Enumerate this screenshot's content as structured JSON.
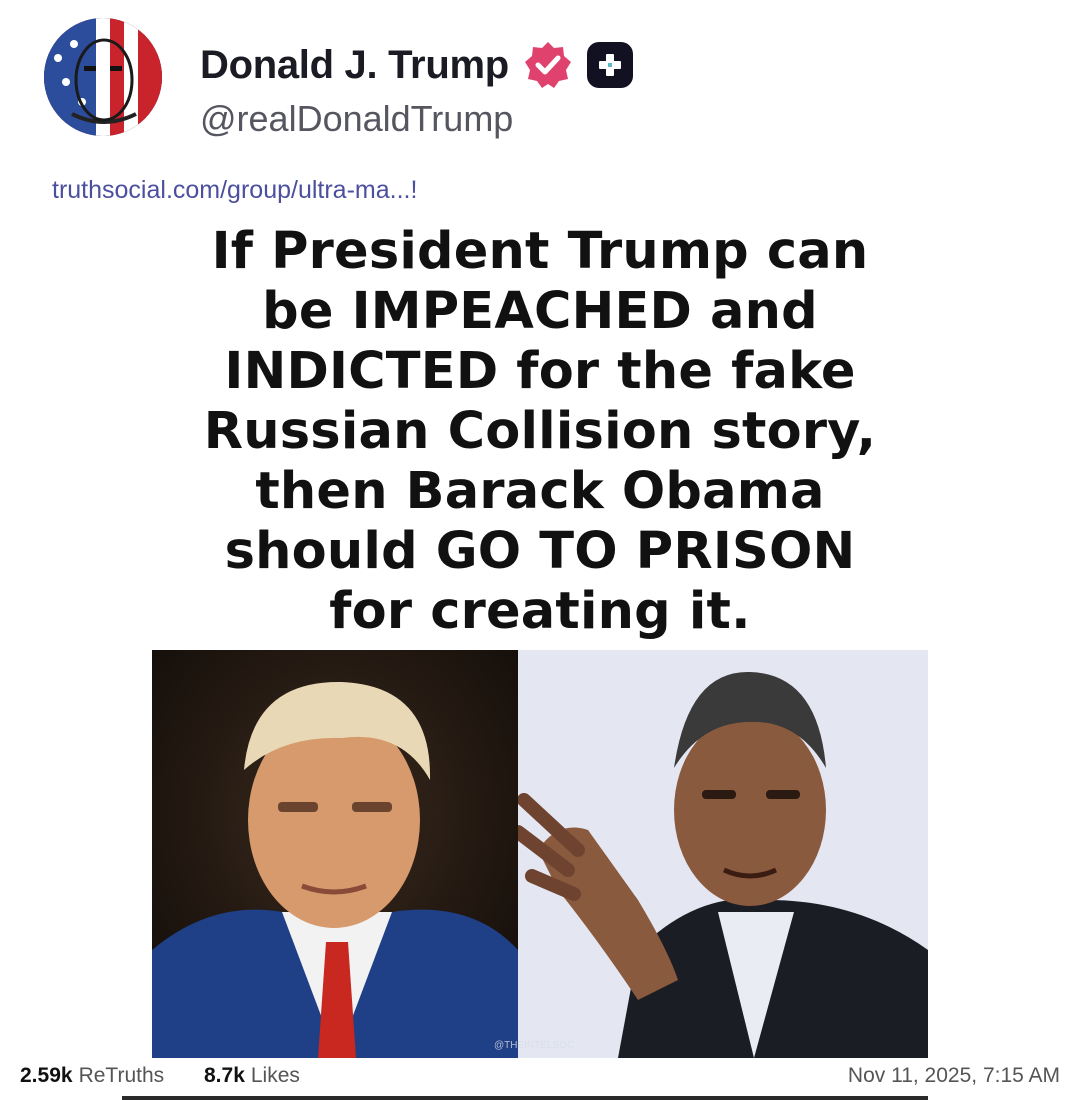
{
  "post": {
    "author": {
      "display_name": "Donald J. Trump",
      "handle": "@realDonaldTrump",
      "verified_icon": "verified-badge-icon",
      "plus_icon": "plus-badge-icon"
    },
    "link_text": "truthsocial.com/group/ultra-ma...!",
    "image_text_lines": [
      "If President Trump can",
      "be IMPEACHED and",
      "INDICTED for the fake",
      "Russian Collision story,",
      "then Barack Obama",
      "should GO TO PRISON",
      "for creating it."
    ],
    "watermark": "@THEINTELSOC",
    "stats": {
      "retruths_count": "2.59k",
      "retruths_label": "ReTruths",
      "likes_count": "8.7k",
      "likes_label": "Likes"
    },
    "timestamp": "Nov 11, 2025, 7:15 AM"
  },
  "colors": {
    "link": "#4b4f9e",
    "verified_badge": "#e0426e",
    "plus_badge_bg": "#111122"
  }
}
